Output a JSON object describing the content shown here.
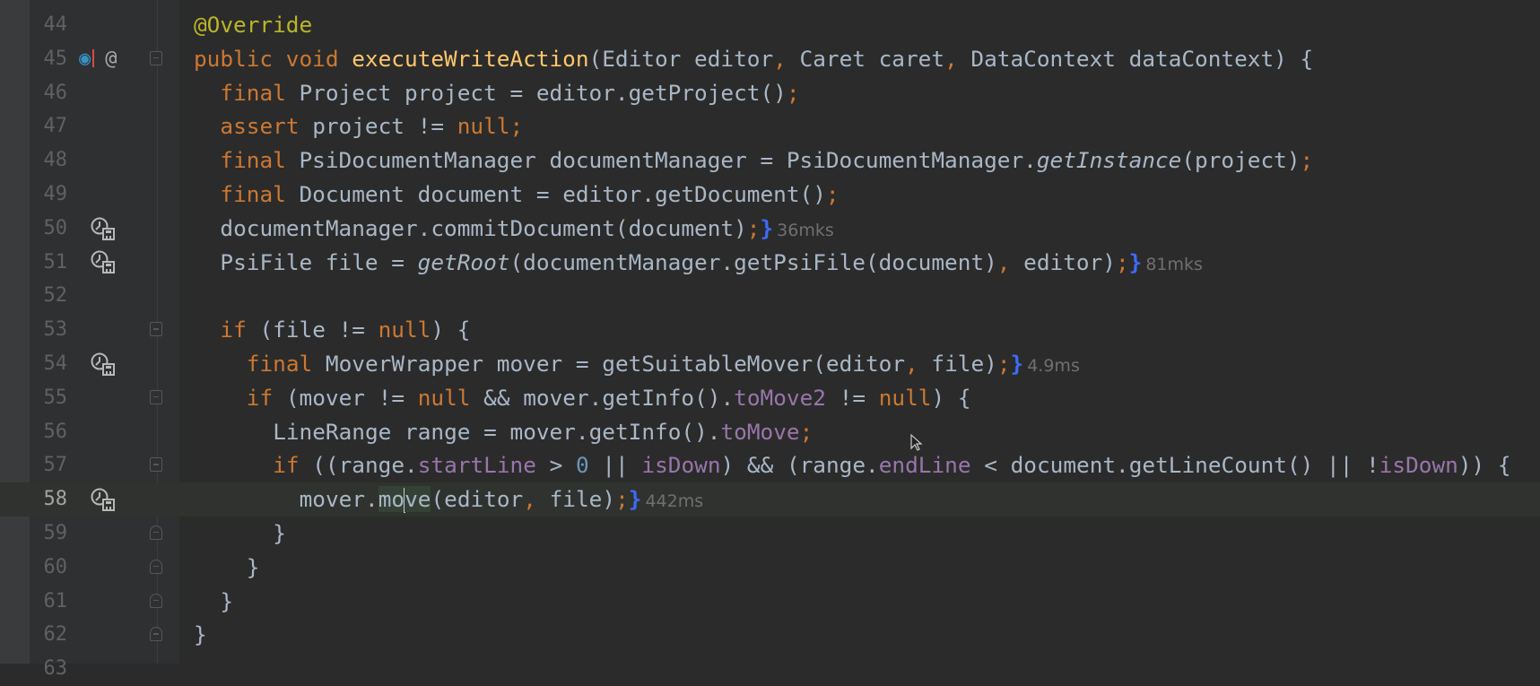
{
  "editor": {
    "lines": [
      {
        "number": "44",
        "indent": 0,
        "tokens": [
          [
            "ann",
            "@Override"
          ]
        ]
      },
      {
        "number": "45",
        "indent": 0,
        "gutter": [
          "implements-override-icon",
          "annotation-at-icon"
        ],
        "fold": "start",
        "tokens": [
          [
            "kw",
            "public void "
          ],
          [
            "fn",
            "executeWriteAction"
          ],
          [
            "",
            "(Editor editor"
          ],
          [
            "semi",
            ", "
          ],
          [
            "",
            "Caret caret"
          ],
          [
            "semi",
            ", "
          ],
          [
            "",
            "DataContext dataContext) {"
          ]
        ]
      },
      {
        "number": "46",
        "indent": 2,
        "tokens": [
          [
            "kw",
            "final "
          ],
          [
            "",
            "Project project = editor.getProject()"
          ],
          [
            "semi",
            ";"
          ]
        ]
      },
      {
        "number": "47",
        "indent": 2,
        "tokens": [
          [
            "kw",
            "assert "
          ],
          [
            "",
            "project != "
          ],
          [
            "kw",
            "null"
          ],
          [
            "semi",
            ";"
          ]
        ]
      },
      {
        "number": "48",
        "indent": 2,
        "tokens": [
          [
            "kw",
            "final "
          ],
          [
            "",
            "PsiDocumentManager documentManager = PsiDocumentManager."
          ],
          [
            "it",
            "getInstance"
          ],
          [
            "",
            "(project)"
          ],
          [
            "semi",
            ";"
          ]
        ]
      },
      {
        "number": "49",
        "indent": 2,
        "tokens": [
          [
            "kw",
            "final "
          ],
          [
            "",
            "Document document = editor.getDocument()"
          ],
          [
            "semi",
            ";"
          ]
        ]
      },
      {
        "number": "50",
        "indent": 2,
        "gutter": [
          "profiler-icon"
        ],
        "tokens": [
          [
            "",
            "documentManager.commitDocument(document)"
          ],
          [
            "semi",
            ";"
          ],
          [
            "br",
            "}"
          ],
          [
            "hint",
            "36mks"
          ]
        ]
      },
      {
        "number": "51",
        "indent": 2,
        "gutter": [
          "profiler-icon"
        ],
        "tokens": [
          [
            "",
            "PsiFile file = "
          ],
          [
            "it",
            "getRoot"
          ],
          [
            "",
            "(documentManager.getPsiFile(document)"
          ],
          [
            "semi",
            ", "
          ],
          [
            "",
            "editor)"
          ],
          [
            "semi",
            ";"
          ],
          [
            "br",
            "}"
          ],
          [
            "hint",
            "81mks"
          ]
        ]
      },
      {
        "number": "52",
        "indent": 0,
        "tokens": []
      },
      {
        "number": "53",
        "indent": 2,
        "fold": "start",
        "tokens": [
          [
            "kw",
            "if "
          ],
          [
            "",
            "(file != "
          ],
          [
            "kw",
            "null"
          ],
          [
            "",
            ") {"
          ]
        ]
      },
      {
        "number": "54",
        "indent": 4,
        "gutter": [
          "profiler-icon"
        ],
        "tokens": [
          [
            "kw",
            "final "
          ],
          [
            "",
            "MoverWrapper mover = getSuitableMover(editor"
          ],
          [
            "semi",
            ", "
          ],
          [
            "",
            "file)"
          ],
          [
            "semi",
            ";"
          ],
          [
            "br",
            "}"
          ],
          [
            "hint",
            "4.9ms"
          ]
        ]
      },
      {
        "number": "55",
        "indent": 4,
        "fold": "start",
        "tokens": [
          [
            "kw",
            "if "
          ],
          [
            "",
            "(mover != "
          ],
          [
            "kw",
            "null "
          ],
          [
            "",
            "&& mover.getInfo()."
          ],
          [
            "fld",
            "toMove2"
          ],
          [
            "",
            " != "
          ],
          [
            "kw",
            "null"
          ],
          [
            "",
            ") {"
          ]
        ]
      },
      {
        "number": "56",
        "indent": 6,
        "tokens": [
          [
            "",
            "LineRange range = mover.getInfo()."
          ],
          [
            "fld",
            "toMove"
          ],
          [
            "semi",
            ";"
          ]
        ]
      },
      {
        "number": "57",
        "indent": 6,
        "fold": "start",
        "tokens": [
          [
            "kw",
            "if "
          ],
          [
            "",
            "((range."
          ],
          [
            "fld",
            "startLine"
          ],
          [
            "",
            " > "
          ],
          [
            "num",
            "0"
          ],
          [
            "",
            " || "
          ],
          [
            "fld",
            "isDown"
          ],
          [
            "",
            ") && (range."
          ],
          [
            "fld",
            "endLine"
          ],
          [
            "",
            " < document.getLineCount() || !"
          ],
          [
            "fld",
            "isDown"
          ],
          [
            "",
            ")) {"
          ]
        ]
      },
      {
        "number": "58",
        "indent": 8,
        "current": true,
        "gutter": [
          "profiler-icon"
        ],
        "tokens": [
          [
            "",
            "mover."
          ],
          [
            "hl",
            "mo"
          ],
          [
            "caret",
            ""
          ],
          [
            "hl",
            "ve"
          ],
          [
            "",
            "(editor"
          ],
          [
            "semi",
            ", "
          ],
          [
            "",
            "file)"
          ],
          [
            "semi",
            ";"
          ],
          [
            "br",
            "}"
          ],
          [
            "hint",
            "442ms"
          ]
        ]
      },
      {
        "number": "59",
        "indent": 6,
        "fold": "end",
        "tokens": [
          [
            "",
            "}"
          ]
        ]
      },
      {
        "number": "60",
        "indent": 4,
        "fold": "end",
        "tokens": [
          [
            "",
            "}"
          ]
        ]
      },
      {
        "number": "61",
        "indent": 2,
        "fold": "end",
        "tokens": [
          [
            "",
            "}"
          ]
        ]
      },
      {
        "number": "62",
        "indent": 0,
        "fold": "end",
        "tokens": [
          [
            "",
            "}"
          ]
        ]
      },
      {
        "number": "63",
        "indent": 0,
        "tokens": []
      }
    ]
  },
  "colors": {
    "keyword": "#cc7832",
    "method": "#ffc66d",
    "field": "#9876aa",
    "annotation": "#bbb529",
    "hint_bracket": "#3d6bff"
  }
}
